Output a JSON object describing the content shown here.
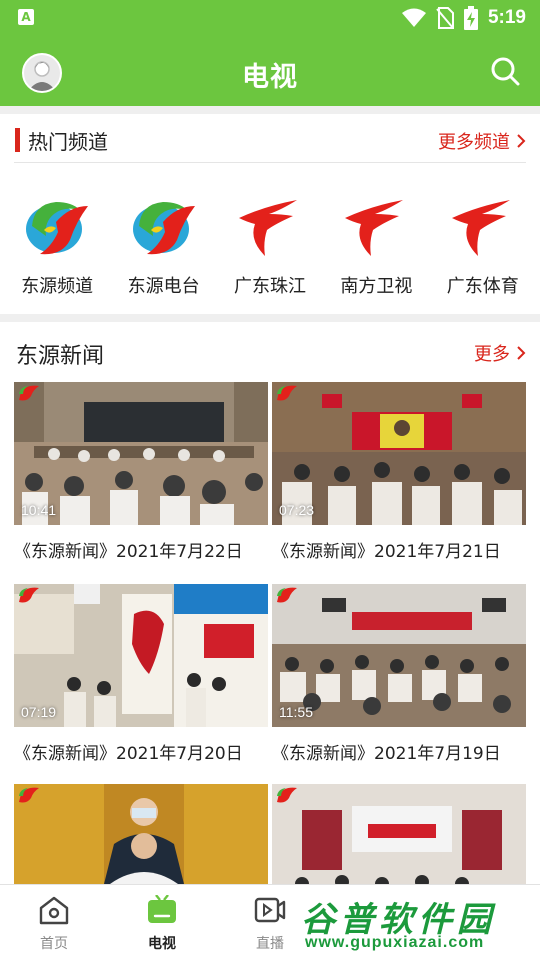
{
  "status_bar": {
    "time": "5:19",
    "notification_icon": "a-icon",
    "icons": [
      "wifi-icon",
      "sim-off-icon",
      "battery-charging-icon"
    ]
  },
  "app_bar": {
    "title": "电视",
    "left_icon": "avatar",
    "right_icon": "search-icon"
  },
  "hot_channels": {
    "title": "热门频道",
    "more_label": "更多频道",
    "items": [
      {
        "name": "东源频道",
        "logo": "dongyuan-logo"
      },
      {
        "name": "东源电台",
        "logo": "dongyuan-logo"
      },
      {
        "name": "广东珠江",
        "logo": "gdtv-logo"
      },
      {
        "name": "南方卫视",
        "logo": "gdtv-logo"
      },
      {
        "name": "广东体育",
        "logo": "gdtv-logo"
      }
    ]
  },
  "news": {
    "title": "东源新闻",
    "more_label": "更多",
    "items": [
      {
        "duration": "10:41",
        "title": "《东源新闻》2021年7月22日"
      },
      {
        "duration": "07:23",
        "title": "《东源新闻》2021年7月21日"
      },
      {
        "duration": "07:19",
        "title": "《东源新闻》2021年7月20日"
      },
      {
        "duration": "11:55",
        "title": "《东源新闻》2021年7月19日"
      },
      {
        "duration": "",
        "title": ""
      },
      {
        "duration": "",
        "title": ""
      }
    ]
  },
  "tabbar": {
    "items": [
      {
        "label": "首页",
        "icon": "home-icon",
        "active": false
      },
      {
        "label": "电视",
        "icon": "tv-icon",
        "active": true
      },
      {
        "label": "直播",
        "icon": "live-icon",
        "active": false
      }
    ]
  },
  "watermark": {
    "line1": "谷普软件园",
    "line2": "www.gupuxiazai.com"
  },
  "colors": {
    "brand_green": "#6cc63f",
    "accent_red": "#d9261c"
  }
}
